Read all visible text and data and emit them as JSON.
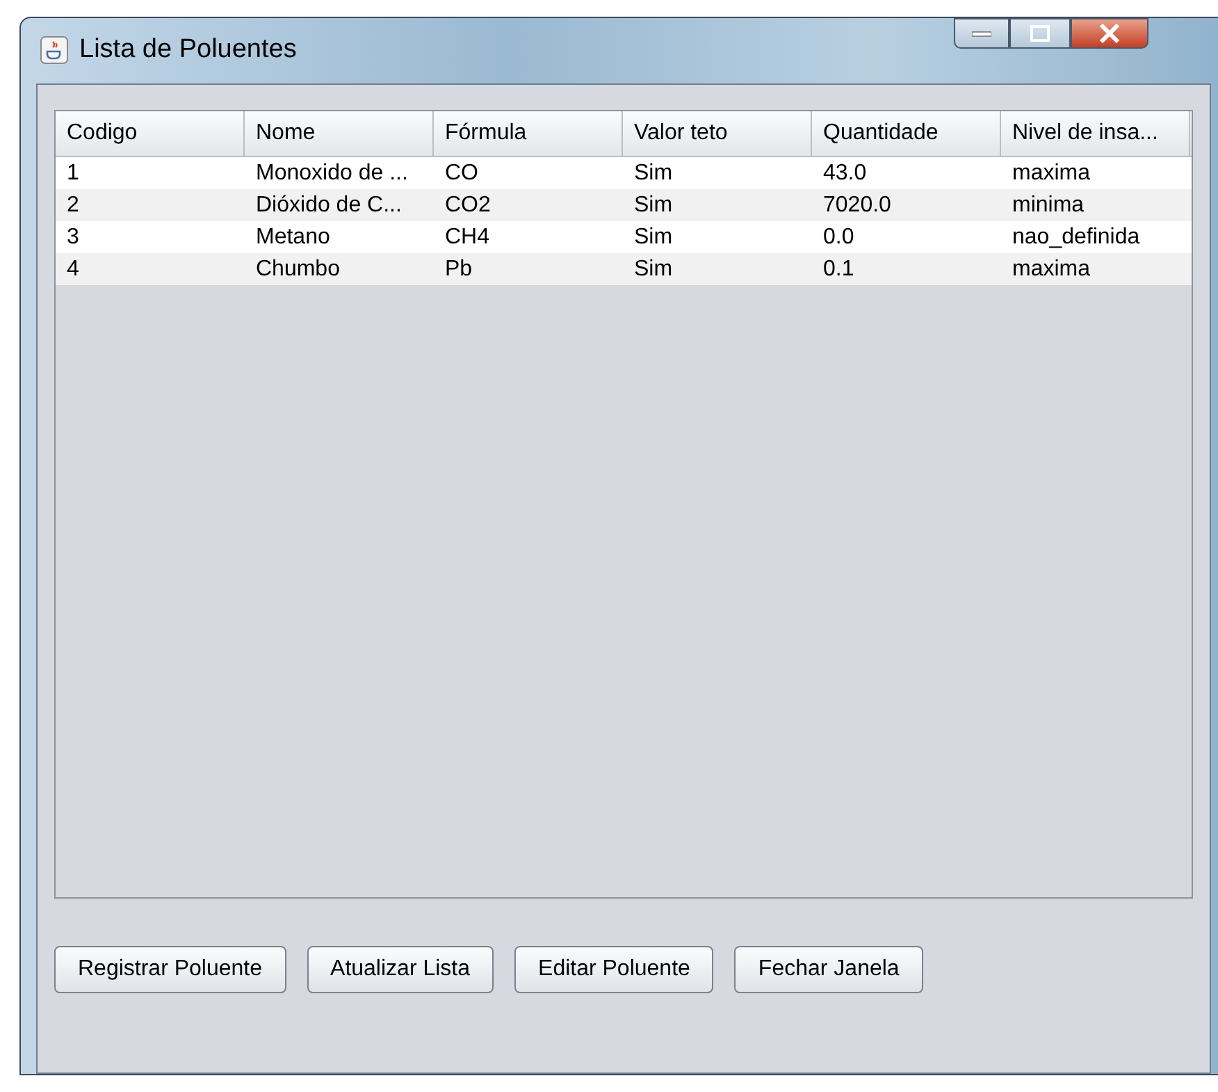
{
  "window": {
    "title": "Lista de Poluentes"
  },
  "table": {
    "columns": [
      "Codigo",
      "Nome",
      "Fórmula",
      "Valor teto",
      "Quantidade",
      "Nivel de insa..."
    ],
    "rows": [
      [
        "1",
        "Monoxido de ...",
        "CO",
        "Sim",
        "43.0",
        "maxima"
      ],
      [
        "2",
        "Dióxido de C...",
        "CO2",
        "Sim",
        "7020.0",
        "minima"
      ],
      [
        "3",
        "Metano",
        "CH4",
        "Sim",
        "0.0",
        "nao_definida"
      ],
      [
        "4",
        "Chumbo",
        "Pb",
        "Sim",
        "0.1",
        "maxima"
      ]
    ]
  },
  "buttons": [
    "Registrar Poluente",
    "Atualizar Lista",
    "Editar Poluente",
    "Fechar Janela"
  ]
}
